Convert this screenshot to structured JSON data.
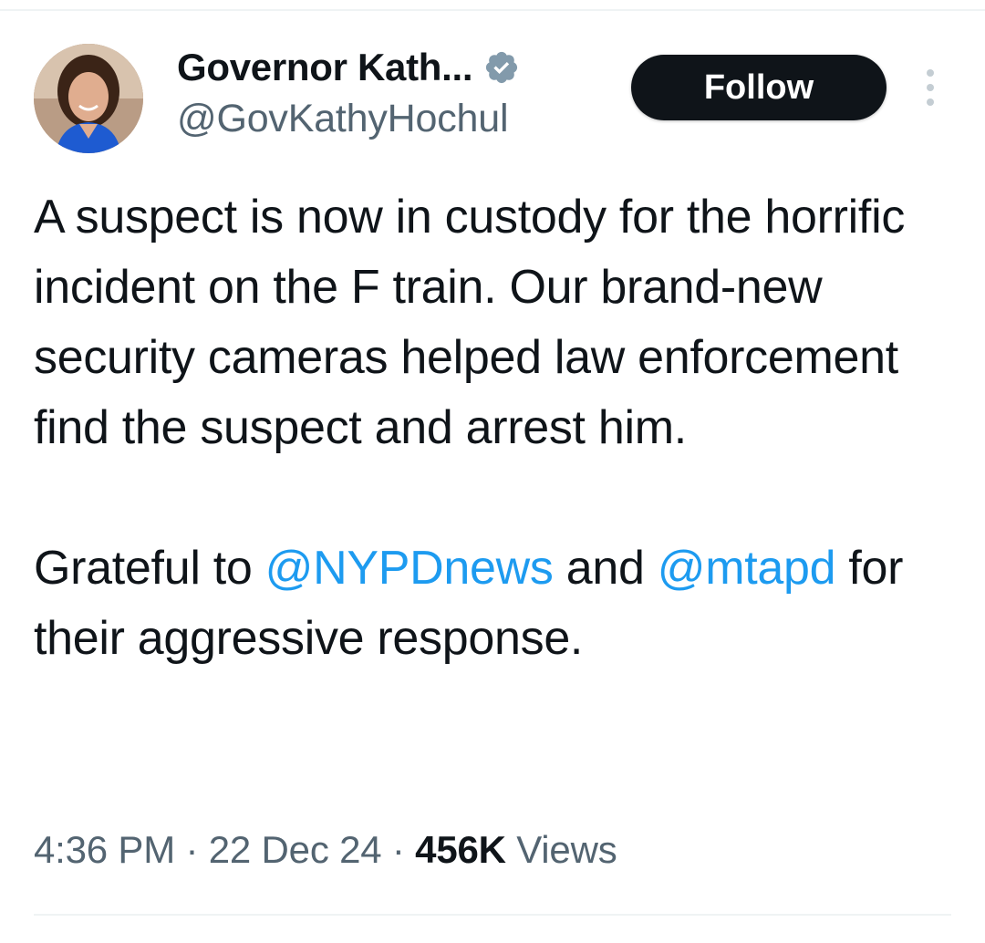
{
  "author": {
    "display_name": "Governor Kath...",
    "handle": "@GovKathyHochul",
    "verified": true,
    "verified_color": "#829aab",
    "avatar_icon": "avatar"
  },
  "actions": {
    "follow_label": "Follow",
    "more_icon": "more-vertical-icon"
  },
  "tweet": {
    "para1": "A suspect is now in custody for the horrific incident on the F train. Our brand-new security cameras helped law enforcement find the suspect and arrest him.",
    "para2_start": "Grateful to ",
    "mention1": "@NYPDnews",
    "para2_mid": " and ",
    "mention2": "@mtapd",
    "para2_end": " for their aggressive response."
  },
  "meta": {
    "time": "4:36 PM",
    "sep1": " · ",
    "date": "22 Dec 24",
    "sep2": " · ",
    "views_count": "456K",
    "views_label": " Views"
  },
  "colors": {
    "text": "#0f1419",
    "secondary": "#536471",
    "link": "#1d9bf0",
    "button_bg": "#0f1419",
    "button_text": "#ffffff"
  }
}
